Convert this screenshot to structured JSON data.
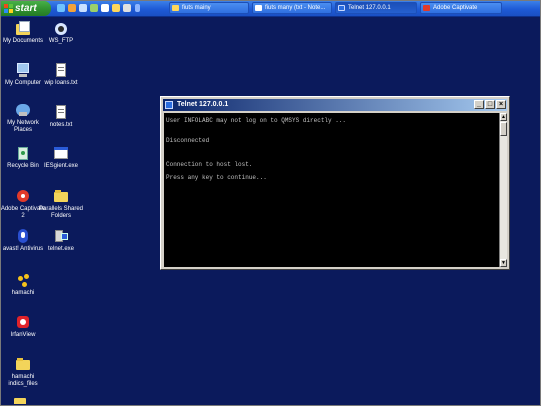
{
  "taskbar": {
    "start_label": "start",
    "tasks": [
      {
        "label": "fiuts mainy",
        "icon": "folder-icon"
      },
      {
        "label": "fiuts many (txt - Note...",
        "icon": "notepad-icon"
      },
      {
        "label": "Telnet 127.0.0.1",
        "icon": "telnet-icon"
      },
      {
        "label": "Adobe Captivate",
        "icon": "captivate-icon"
      }
    ]
  },
  "desktop_icons": [
    {
      "label": "My Documents",
      "icon": "my-documents-icon"
    },
    {
      "label": "WS_FTP",
      "icon": "ws-ftp-icon"
    },
    {
      "label": "My Computer",
      "icon": "my-computer-icon"
    },
    {
      "label": "wip loans.txt",
      "icon": "text-file-icon"
    },
    {
      "label": "My Network Places",
      "icon": "network-places-icon"
    },
    {
      "label": "notes.txt",
      "icon": "text-file-icon"
    },
    {
      "label": "Recycle Bin",
      "icon": "recycle-bin-icon"
    },
    {
      "label": "IESgient.exe",
      "icon": "application-icon"
    },
    {
      "label": "Adobe Captivate 2",
      "icon": "captivate-icon"
    },
    {
      "label": "Parallels Shared Folders",
      "icon": "shared-folder-icon"
    },
    {
      "label": "avast! Antivirus",
      "icon": "antivirus-icon"
    },
    {
      "label": "telnet.exe",
      "icon": "telnet-exe-icon"
    },
    {
      "label": "hamachi",
      "icon": "hamachi-icon"
    },
    {
      "label": "IrfanView",
      "icon": "irfanview-icon"
    },
    {
      "label": "hamachi indics_files",
      "icon": "folder-icon"
    }
  ],
  "telnet_window": {
    "title": "Telnet 127.0.0.1",
    "buttons": {
      "minimize": "_",
      "maximize": "□",
      "close": "×"
    },
    "lines": [
      "User INFOLABC may not log on to QMSYS directly ...",
      "Disconnected",
      "Connection to host lost.",
      "Press any key to continue..."
    ]
  }
}
